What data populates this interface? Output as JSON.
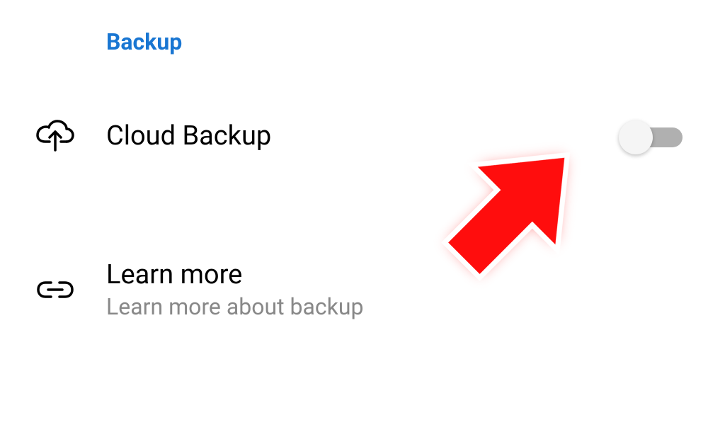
{
  "section": {
    "header": "Backup"
  },
  "cloud_backup": {
    "title": "Cloud Backup",
    "toggle_state": "off"
  },
  "learn_more": {
    "title": "Learn more",
    "subtitle": "Learn more about backup"
  },
  "colors": {
    "accent": "#1976d2",
    "annotation": "#ff0000"
  }
}
